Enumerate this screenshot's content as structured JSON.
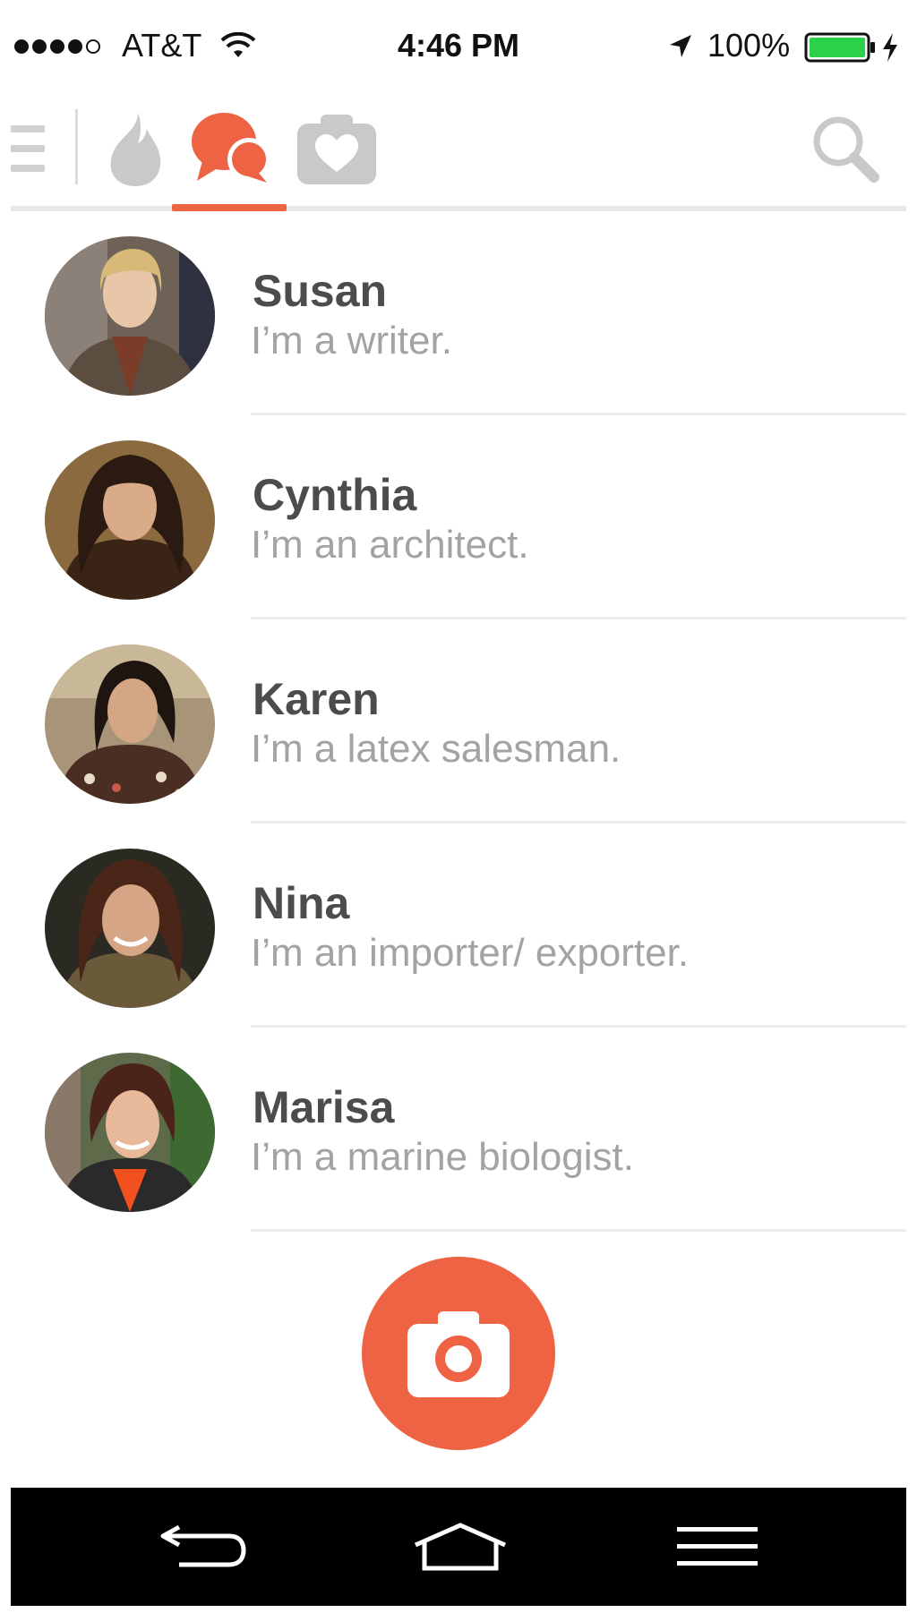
{
  "status_bar": {
    "carrier": "AT&T",
    "time": "4:46 PM",
    "battery": "100%",
    "signal_bars_filled": 4,
    "signal_bars_total": 5,
    "battery_level": 1.0,
    "battery_color": "#2bd14a"
  },
  "nav": {
    "tabs": [
      {
        "name": "flame-icon",
        "active": false
      },
      {
        "name": "chat-icon",
        "active": true
      },
      {
        "name": "camera-heart-icon",
        "active": false
      }
    ],
    "accent_color": "#ee6344",
    "inactive_color": "#c9c9c9"
  },
  "chats": [
    {
      "name": "Susan",
      "message": "I’m a writer."
    },
    {
      "name": "Cynthia",
      "message": "I’m an architect."
    },
    {
      "name": "Karen",
      "message": "I’m a latex salesman."
    },
    {
      "name": "Nina",
      "message": "I’m an importer/ exporter."
    },
    {
      "name": "Marisa",
      "message": "I’m a marine biologist."
    }
  ],
  "fab": {
    "icon": "camera-icon",
    "color": "#ee6344"
  },
  "android_nav": {
    "icons": [
      "back-icon",
      "home-icon",
      "recent-apps-icon"
    ]
  }
}
